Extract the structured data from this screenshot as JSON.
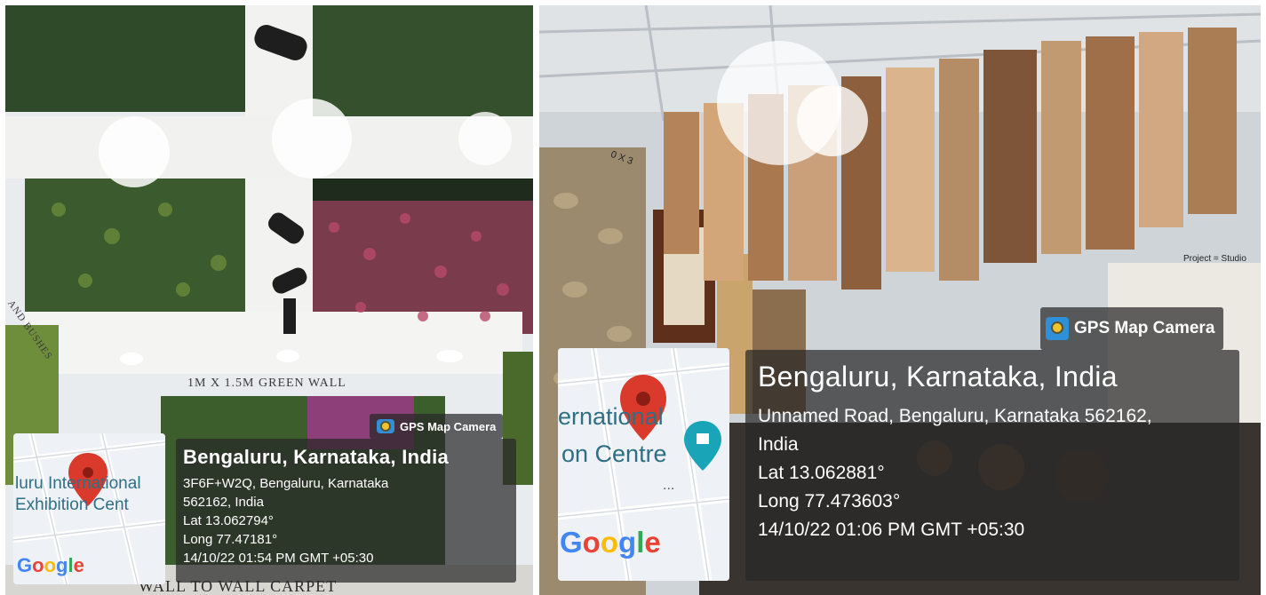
{
  "left_photo": {
    "wall_title": "1M X 1.5M GREEN WALL",
    "wall_bottom_text": "WALL TO WALL CARPET",
    "wall_side_text": "AND BUSHES",
    "gps_tag": {
      "icon": "gps-map-camera-icon",
      "label": "GPS Map Camera"
    },
    "map": {
      "label_top": "luru International",
      "label_bottom": "Exhibition Cent",
      "logo": "Google",
      "pin_icon": "location-pin-icon"
    },
    "info": {
      "city": "Bengaluru, Karnataka, India",
      "address_line1": "3F6F+W2Q, Bengaluru, Karnataka",
      "address_line2": "562162, India",
      "lat": "Lat 13.062794°",
      "long": "Long 77.47181°",
      "timestamp": "14/10/22 01:54 PM GMT +05:30"
    }
  },
  "right_photo": {
    "project_text": "Project = Studio",
    "size_text": "0 X 3",
    "gps_tag": {
      "icon": "gps-map-camera-icon",
      "label": "GPS Map Camera"
    },
    "map": {
      "label_top": "ernational",
      "label_bottom": "on Centre",
      "extra": "...",
      "logo": "Google",
      "pin_icon": "location-pin-icon",
      "poi_icon": "landmark-icon"
    },
    "info": {
      "city": "Bengaluru, Karnataka, India",
      "address_line1": "Unnamed Road, Bengaluru, Karnataka 562162,",
      "address_line2": "India",
      "lat": "Lat 13.062881°",
      "long": "Long 77.473603°",
      "timestamp": "14/10/22 01:06 PM GMT +05:30"
    }
  }
}
